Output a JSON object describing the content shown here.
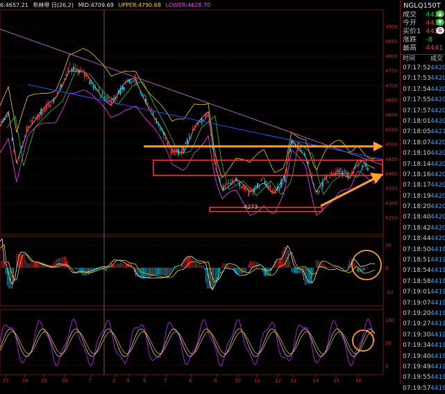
{
  "header": {
    "prefix": "6:4657.21",
    "indicator_name": "布林带 日(26,2)",
    "mid": "MID:4709.69",
    "upper": "UPPER:4790.68",
    "lower": "LOWER:4628.70",
    "colors": {
      "mid": "#e8e8e8",
      "upper": "#ffd000",
      "lower": "#ff40ff"
    }
  },
  "price_axis": [
    "4900",
    "4850",
    "4800",
    "4750",
    "4700",
    "4650",
    "4600",
    "4550",
    "4500",
    "4450",
    "4400",
    "4350",
    "4300",
    "4250"
  ],
  "macd_axis": [
    "50",
    "0",
    "-50"
  ],
  "kd_axis": [
    "100",
    "50",
    "0"
  ],
  "date_axis": [
    "27",
    "28",
    "29",
    "30",
    "7",
    "2",
    "3",
    "6",
    "7",
    "8",
    "9",
    "10",
    "11",
    "12",
    "13",
    "14",
    "15",
    "16"
  ],
  "low_label": "4273",
  "sidebar": {
    "title": "NGLQ150T",
    "quotes": [
      {
        "label": "成交",
        "value": "4420",
        "color": "green"
      },
      {
        "label": "今开",
        "value": "443",
        "color": "red"
      },
      {
        "label": "买价1",
        "value": "442",
        "color": "red"
      },
      {
        "label": "涨跌",
        "value": "-8",
        "color": "green"
      },
      {
        "label": "最高",
        "value": "4441",
        "color": "red"
      }
    ],
    "ticks_header": {
      "time": "时间",
      "price": "成交"
    },
    "ticks": [
      {
        "time": "07:17:52",
        "price": "4420"
      },
      {
        "time": "07:17:53",
        "price": "4420"
      },
      {
        "time": "07:17:54",
        "price": "4420"
      },
      {
        "time": "07:17:55",
        "price": "4420"
      },
      {
        "time": "07:17:57",
        "price": "4420"
      },
      {
        "time": "07:18:01",
        "price": "4420"
      },
      {
        "time": "07:18:05",
        "price": "4421"
      },
      {
        "time": "07:18:07",
        "price": "4420"
      },
      {
        "time": "07:18:10",
        "price": "4420"
      },
      {
        "time": "07:18:14",
        "price": "4420"
      },
      {
        "time": "07:18:16",
        "price": "4420"
      },
      {
        "time": "07:18:17",
        "price": "4420"
      },
      {
        "time": "07:18:19",
        "price": "4420"
      },
      {
        "time": "07:18:20",
        "price": "4420"
      },
      {
        "time": "07:18:40",
        "price": "4420"
      },
      {
        "time": "07:18:42",
        "price": "4420"
      },
      {
        "time": "07:18:44",
        "price": "4420"
      },
      {
        "time": "07:18:50",
        "price": "4419"
      },
      {
        "time": "07:18:51",
        "price": "4419"
      },
      {
        "time": "07:18:54",
        "price": "4419"
      },
      {
        "time": "07:18:58",
        "price": "4419"
      },
      {
        "time": "07:19:01",
        "price": "4419"
      },
      {
        "time": "07:19:07",
        "price": "4419"
      },
      {
        "time": "07:19:20",
        "price": "4419"
      },
      {
        "time": "07:19:27",
        "price": "4419"
      },
      {
        "time": "07:19:30",
        "price": "4419"
      },
      {
        "time": "07:19:34",
        "price": "4419"
      },
      {
        "time": "07:19:40",
        "price": "4419"
      },
      {
        "time": "07:19:49",
        "price": "4419"
      },
      {
        "time": "07:19:55",
        "price": "4419"
      },
      {
        "time": "07:19:57",
        "price": "4419"
      }
    ]
  },
  "colors": {
    "up_candle": "#ff3030",
    "down_candle": "#00e0ff",
    "grid": "#6a1a1a",
    "annotation_red": "#ff3030",
    "annotation_orange": "#ffa030",
    "trend_line": "#b060c0",
    "ma_blue": "#3050ff",
    "ma_green": "#40c040",
    "kd_purple": "#c020e0"
  },
  "icons": [
    "up-arrow-icon",
    "down-arrow-icon",
    "g-icon"
  ]
}
